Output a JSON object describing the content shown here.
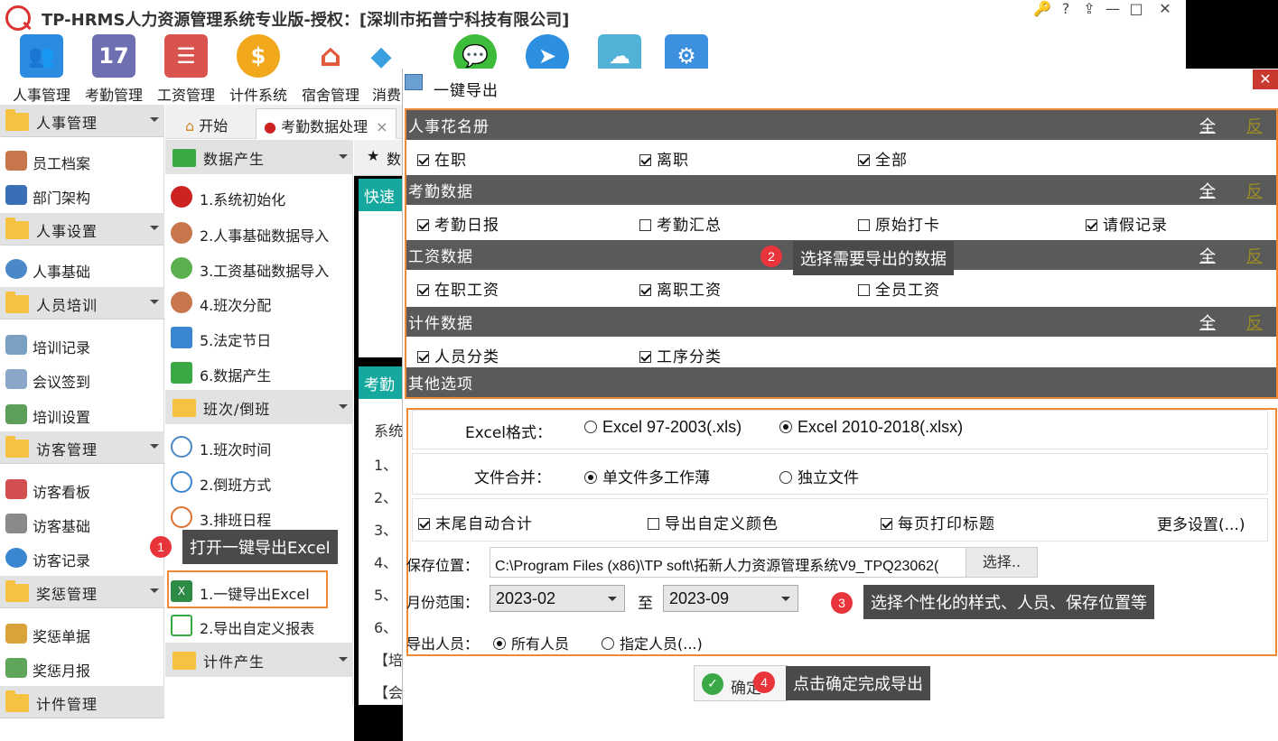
{
  "app": {
    "title": "TP-HRMS人力资源管理系统专业版-授权：[深圳市拓普宁科技有限公司]",
    "window_controls": [
      "🔑",
      "?",
      "⇪",
      "—",
      "□",
      "✕"
    ]
  },
  "modules": [
    {
      "label": "人事管理",
      "icon": "people-icon",
      "color": "#2b8be0"
    },
    {
      "label": "考勤管理",
      "icon": "calendar-icon",
      "color": "#6d6fb0"
    },
    {
      "label": "工资管理",
      "icon": "payroll-icon",
      "color": "#d9534f"
    },
    {
      "label": "计件系统",
      "icon": "money-bag-icon",
      "color": "#f2a81d"
    },
    {
      "label": "宿舍管理",
      "icon": "house-gear-icon",
      "color": "#e05a3a"
    },
    {
      "label": "消费",
      "icon": "cube-icon",
      "color": "#3aa0e0"
    },
    {
      "label": "",
      "icon": "wechat-icon",
      "color": "#3dbb3a"
    },
    {
      "label": "",
      "icon": "dingtalk-icon",
      "color": "#2d8fe0"
    },
    {
      "label": "",
      "icon": "cloud-icon",
      "color": "#4fb2d6"
    },
    {
      "label": "",
      "icon": "settings-icon",
      "color": "#3d8fe0"
    }
  ],
  "tabs": {
    "start": "开始",
    "attendance": "考勤数据处理",
    "close": "×"
  },
  "sidebar": {
    "groups": [
      {
        "label": "人事管理"
      },
      {
        "label": "人事设置"
      },
      {
        "label": "人员培训"
      },
      {
        "label": "访客管理"
      },
      {
        "label": "奖惩管理"
      },
      {
        "label": "计件管理"
      }
    ],
    "items": [
      {
        "label": "员工档案"
      },
      {
        "label": "部门架构"
      },
      {
        "label": "人事基础"
      },
      {
        "label": "培训记录"
      },
      {
        "label": "会议签到"
      },
      {
        "label": "培训设置"
      },
      {
        "label": "访客看板"
      },
      {
        "label": "访客基础"
      },
      {
        "label": "访客记录"
      },
      {
        "label": "奖惩单据"
      },
      {
        "label": "奖惩月报"
      }
    ]
  },
  "col2": {
    "groups": [
      {
        "label": "数据产生"
      },
      {
        "label": "班次/倒班"
      },
      {
        "label": "计件产生"
      }
    ],
    "items": [
      {
        "label": "1.系统初始化"
      },
      {
        "label": "2.人事基础数据导入"
      },
      {
        "label": "3.工资基础数据导入"
      },
      {
        "label": "4.班次分配"
      },
      {
        "label": "5.法定节日"
      },
      {
        "label": "6.数据产生"
      },
      {
        "label": "1.班次时间"
      },
      {
        "label": "2.倒班方式"
      },
      {
        "label": "3.排班日程"
      },
      {
        "label": "1.一键导出Excel"
      },
      {
        "label": "2.导出自定义报表"
      }
    ]
  },
  "bg": {
    "tab_partial": "数",
    "quick": "快速",
    "kaoqin": "考勤",
    "lines": [
      "系统",
      "1、",
      "2、",
      "3、",
      "4、",
      "5、",
      "6、",
      "【培",
      "【会"
    ]
  },
  "dialog": {
    "title": "一键导出",
    "close": "✕",
    "all_label": "全",
    "invert_label": "反",
    "sections": [
      {
        "title": "人事花名册",
        "items": [
          {
            "label": "在职",
            "checked": true
          },
          {
            "label": "离职",
            "checked": true
          },
          {
            "label": "全部",
            "checked": true
          }
        ]
      },
      {
        "title": "考勤数据",
        "items": [
          {
            "label": "考勤日报",
            "checked": true
          },
          {
            "label": "考勤汇总",
            "checked": false
          },
          {
            "label": "原始打卡",
            "checked": false
          },
          {
            "label": "请假记录",
            "checked": true
          }
        ]
      },
      {
        "title": "工资数据",
        "items": [
          {
            "label": "在职工资",
            "checked": true
          },
          {
            "label": "离职工资",
            "checked": true
          },
          {
            "label": "全员工资",
            "checked": false
          }
        ]
      },
      {
        "title": "计件数据",
        "items": [
          {
            "label": "人员分类",
            "checked": true
          },
          {
            "label": "工序分类",
            "checked": true
          }
        ]
      },
      {
        "title": "其他选项",
        "items": []
      }
    ],
    "excel_format": {
      "label": "Excel格式：",
      "options": [
        {
          "label": "Excel 97-2003(.xls)",
          "selected": false
        },
        {
          "label": "Excel 2010-2018(.xlsx)",
          "selected": true
        }
      ]
    },
    "file_merge": {
      "label": "文件合并：",
      "options": [
        {
          "label": "单文件多工作薄",
          "selected": true
        },
        {
          "label": "独立文件",
          "selected": false
        }
      ]
    },
    "extra": {
      "auto_total": {
        "label": "末尾自动合计",
        "checked": true
      },
      "custom_color": {
        "label": "导出自定义颜色",
        "checked": false
      },
      "print_title": {
        "label": "每页打印标题",
        "checked": true
      },
      "more": "更多设置(...)"
    },
    "save": {
      "label": "保存位置：",
      "path": "C:\\Program Files (x86)\\TP soft\\拓新人力资源管理系统V9_TPQ23062(",
      "browse": "选择.."
    },
    "month_range": {
      "label": "月份范围：",
      "from": "2023-02",
      "sep": "至",
      "to": "2023-09"
    },
    "export_people": {
      "label": "导出人员：",
      "options": [
        {
          "label": "所有人员",
          "selected": true
        },
        {
          "label": "指定人员(...)",
          "selected": false
        }
      ]
    },
    "confirm": "确定"
  },
  "callouts": [
    {
      "num": "1",
      "text": "打开一键导出Excel"
    },
    {
      "num": "2",
      "text": "选择需要导出的数据"
    },
    {
      "num": "3",
      "text": "选择个性化的样式、人员、保存位置等"
    },
    {
      "num": "4",
      "text": "点击确定完成导出"
    }
  ],
  "colors": {
    "accent_orange": "#ee8a35",
    "section_grey": "#5a5a5a",
    "badge_red": "#e8343a",
    "teal": "#15a89e"
  }
}
